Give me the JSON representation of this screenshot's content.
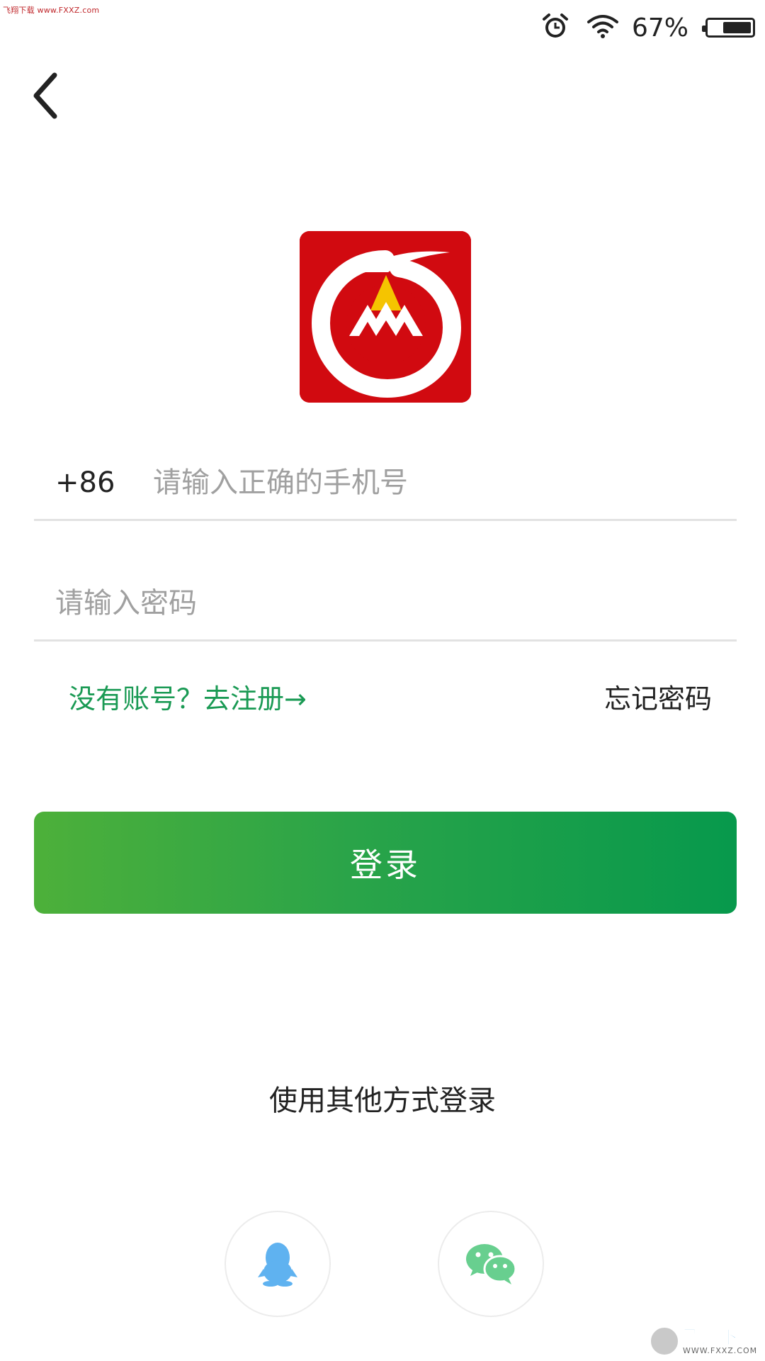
{
  "watermark_top": "飞翔下载 www.FXXZ.com",
  "status": {
    "battery_pct": "67%",
    "battery_level": 0.67,
    "icons": [
      "alarm-icon",
      "wifi-icon",
      "battery-icon"
    ]
  },
  "nav": {
    "back_icon": "chevron-left-icon"
  },
  "logo": {
    "name": "app-logo",
    "colors": {
      "background": "#d10a10",
      "ring": "#ffffff",
      "flame": "#f5c400"
    }
  },
  "form": {
    "country_code": "+86",
    "phone_placeholder": "请输入正确的手机号",
    "password_placeholder": "请输入密码",
    "register_link": "没有账号？去注册→",
    "forgot_password": "忘记密码",
    "login_button": "登录"
  },
  "other_login": {
    "title": "使用其他方式登录",
    "options": [
      {
        "name": "qq",
        "icon": "qq-penguin-icon",
        "color": "#5fb2f0"
      },
      {
        "name": "wechat",
        "icon": "wechat-icon",
        "color": "#68cf8f"
      }
    ]
  },
  "watermark_corner": {
    "main": "飞翔下载",
    "sub": "WWW.FXXZ.COM"
  },
  "colors": {
    "accent_green": "#1a9a54",
    "button_start": "#4db03a",
    "button_end": "#07994c"
  }
}
